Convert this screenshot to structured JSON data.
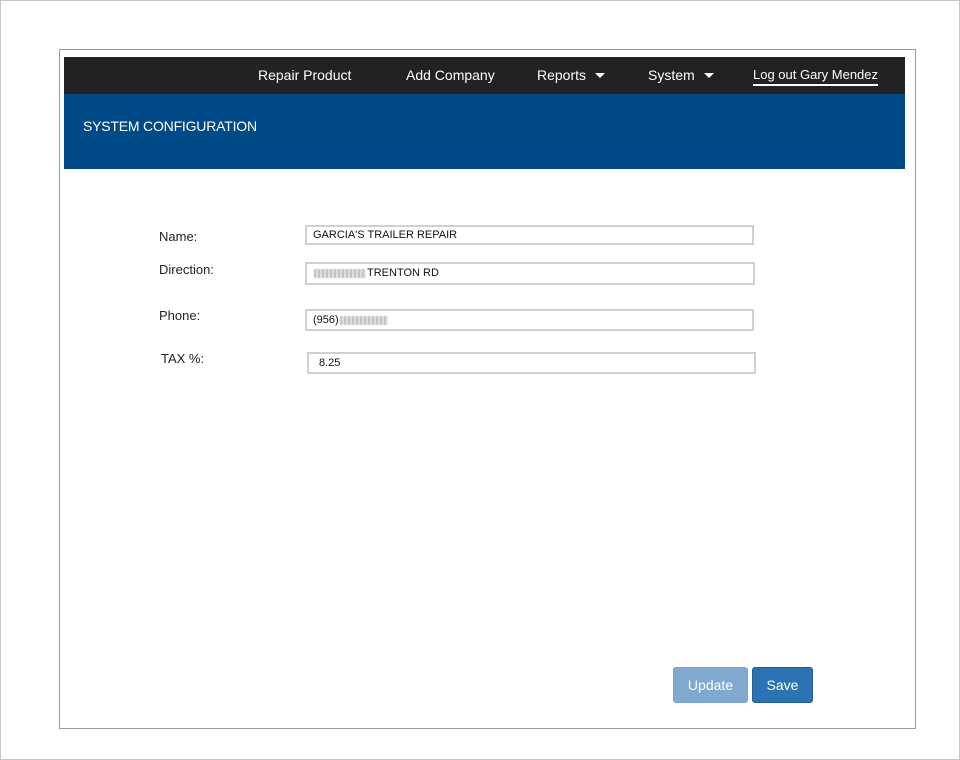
{
  "nav": {
    "items": [
      {
        "label": "Repair Product"
      },
      {
        "label": "Add Company"
      },
      {
        "label": "Reports"
      },
      {
        "label": "System"
      }
    ],
    "logout_label": "Log out Gary Mendez"
  },
  "banner": {
    "title": "SYSTEM CONFIGURATION"
  },
  "form": {
    "name_label": "Name:",
    "name_value": "GARCIA'S TRAILER REPAIR",
    "direction_label": "Direction:",
    "direction_value": "TRENTON RD",
    "phone_label": "Phone:",
    "phone_value": "(956)",
    "tax_label": "TAX %:",
    "tax_value": "8.25"
  },
  "buttons": {
    "update_label": "Update",
    "save_label": "Save"
  },
  "colors": {
    "navbar": "#222222",
    "banner": "#004a88",
    "update_button": "#7fa9cf",
    "save_button": "#2c73b4"
  }
}
